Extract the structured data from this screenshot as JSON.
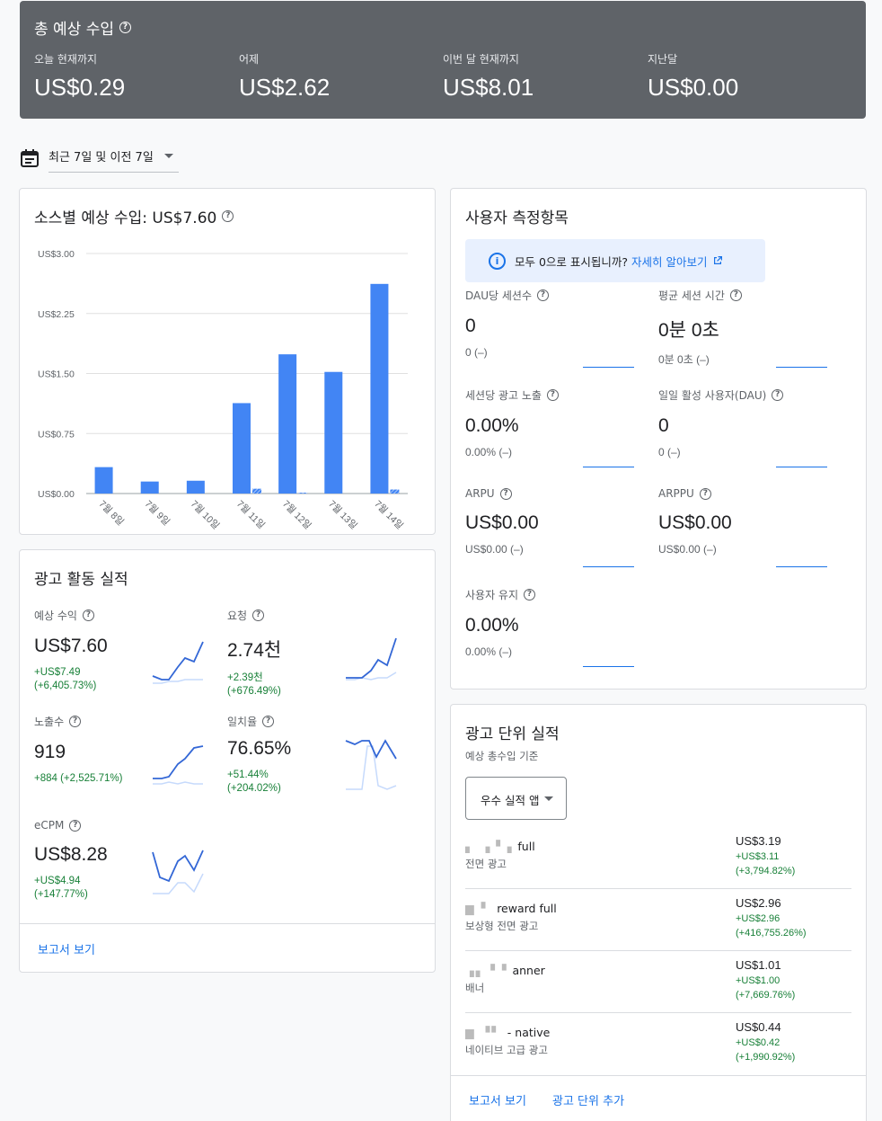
{
  "summary": {
    "title": "총 예상 수입",
    "metrics": [
      {
        "label": "오늘 현재까지",
        "value": "US$0.29"
      },
      {
        "label": "어제",
        "value": "US$2.62"
      },
      {
        "label": "이번 달 현재까지",
        "value": "US$8.01"
      },
      {
        "label": "지난달",
        "value": "US$0.00"
      }
    ]
  },
  "date_range": "최근 7일 및 이전 7일",
  "source_card": {
    "title": "소스별 예상 수입: US$7.60"
  },
  "chart_data": {
    "type": "bar",
    "categories": [
      "7월 8일",
      "7월 9일",
      "7월 10일",
      "7월 11일",
      "7월 12일",
      "7월 13일",
      "7월 14일"
    ],
    "series": [
      {
        "values": [
          0.33,
          0.15,
          0.16,
          1.13,
          1.74,
          1.52,
          2.62
        ],
        "color": "#4285f4"
      },
      {
        "values": [
          0.0,
          0.0,
          0.0,
          0.06,
          0.01,
          0.0,
          0.05
        ],
        "color": "#4285f4",
        "hatched": true
      }
    ],
    "yticks": [
      "US$0.00",
      "US$0.75",
      "US$1.50",
      "US$2.25",
      "US$3.00"
    ],
    "ylim": [
      0,
      3.0
    ]
  },
  "ad_perf": {
    "title": "광고 활동 실적",
    "items": [
      {
        "label": "예상 수익",
        "value": "US$7.60",
        "change": "+US$7.49",
        "change2": "(+6,405.73%)"
      },
      {
        "label": "요청",
        "value": "2.74천",
        "change": "+2.39천",
        "change2": "(+676.49%)"
      },
      {
        "label": "노출수",
        "value": "919",
        "change": "+884 (+2,525.71%)",
        "change2": ""
      },
      {
        "label": "일치율",
        "value": "76.65%",
        "change": "+51.44%",
        "change2": "(+204.02%)"
      },
      {
        "label": "eCPM",
        "value": "US$8.28",
        "change": "+US$4.94",
        "change2": "(+147.77%)"
      }
    ],
    "report_link": "보고서 보기"
  },
  "user_metrics": {
    "title": "사용자 측정항목",
    "info_text": "모두 0으로 표시됩니까?",
    "info_link": "자세히 알아보기",
    "items": [
      {
        "label": "DAU당 세션수",
        "value": "0",
        "sub": "0 (–)"
      },
      {
        "label": "평균 세션 시간",
        "value": "0분 0초",
        "sub": "0분 0초 (–)"
      },
      {
        "label": "세션당 광고 노출",
        "value": "0.00%",
        "sub": "0.00% (–)"
      },
      {
        "label": "일일 활성 사용자(DAU)",
        "value": "0",
        "sub": "0 (–)"
      },
      {
        "label": "ARPU",
        "value": "US$0.00",
        "sub": "US$0.00 (–)"
      },
      {
        "label": "ARPPU",
        "value": "US$0.00",
        "sub": "US$0.00 (–)"
      },
      {
        "label": "사용자 유지",
        "value": "0.00%",
        "sub": "0.00% (–)"
      }
    ]
  },
  "ad_units": {
    "title": "광고 단위 실적",
    "subtitle": "예상 총수입 기준",
    "dropdown": "우수 실적 앱",
    "rows": [
      {
        "name": "full",
        "type": "전면 광고",
        "amount": "US$3.19",
        "change": "+US$3.11",
        "change2": "(+3,794.82%)"
      },
      {
        "name": "reward full",
        "type": "보상형 전면 광고",
        "amount": "US$2.96",
        "change": "+US$2.96",
        "change2": "(+416,755.26%)"
      },
      {
        "name": "anner",
        "type": "배너",
        "amount": "US$1.01",
        "change": "+US$1.00",
        "change2": "(+7,669.76%)"
      },
      {
        "name": "- native",
        "type": "네이티브 고급 광고",
        "amount": "US$0.44",
        "change": "+US$0.42",
        "change2": "(+1,990.92%)"
      }
    ],
    "report_link": "보고서 보기",
    "add_link": "광고 단위 추가"
  }
}
